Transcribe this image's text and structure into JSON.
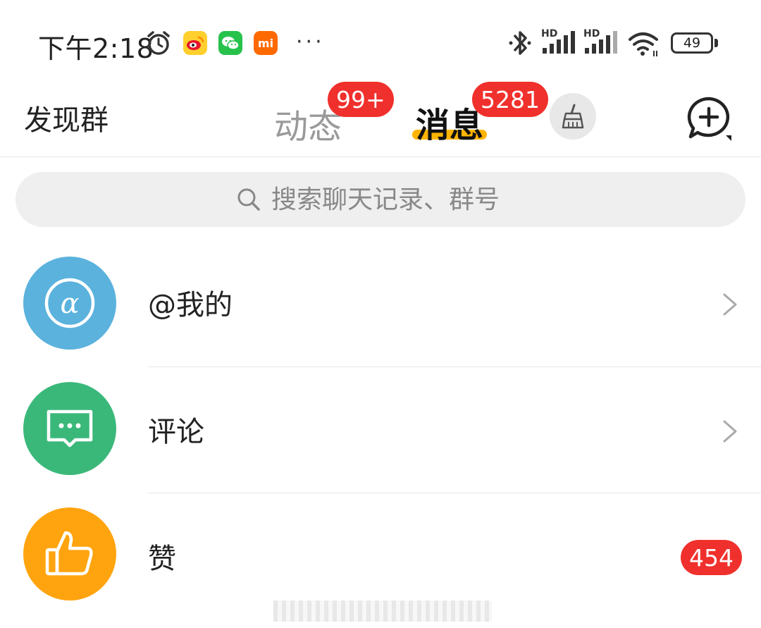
{
  "status_bar": {
    "time": "下午2:18",
    "apps": [
      {
        "name": "weibo",
        "label": "",
        "color": "#ffcf2e"
      },
      {
        "name": "wechat",
        "label": "",
        "color": "#27c24c"
      },
      {
        "name": "xiaomi",
        "label": "mi",
        "color": "#ff6a00"
      }
    ],
    "more": "···",
    "signal_1_label": "HD",
    "signal_2_label": "HD",
    "battery": "49",
    "battery_level_percent": 49
  },
  "header": {
    "discover_label": "发现群",
    "tabs": [
      {
        "label": "动态",
        "badge": "99+",
        "active": false
      },
      {
        "label": "消息",
        "badge": "5281",
        "active": true
      }
    ],
    "clean_icon": "broom-icon",
    "add_icon": "add-chat-icon"
  },
  "search": {
    "placeholder": "搜索聊天记录、群号"
  },
  "list": [
    {
      "label": "@我的",
      "icon": "at-icon",
      "color": "#5ab2dd"
    },
    {
      "label": "评论",
      "icon": "comment-icon",
      "color": "#3ab87a"
    },
    {
      "label": "赞",
      "icon": "thumbs-up-icon",
      "color": "#ffa40f",
      "badge": "454"
    }
  ],
  "colors": {
    "accent_underline": "#ffb400",
    "badge_red": "#f0302c"
  }
}
